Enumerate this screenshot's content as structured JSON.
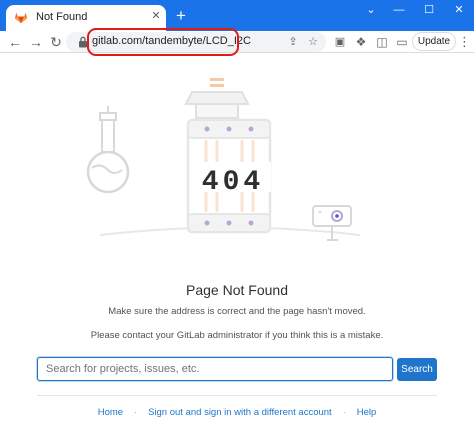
{
  "browser": {
    "tab": {
      "title": "Not Found",
      "favicon": "gitlab-fox-icon",
      "close": "✕"
    },
    "new_tab": "+",
    "window_controls": {
      "minimize": "—",
      "maximize": "☐",
      "close": "✕"
    },
    "nav": {
      "back": "←",
      "forward": "→",
      "reload": "↻"
    },
    "url": "gitlab.com/tandembyte/LCD_I2C",
    "update_label": "Update",
    "menu": "⋮",
    "accent_color": "#1a73e8",
    "highlight_color": "#e01b1b"
  },
  "page": {
    "error_code": "404",
    "title": "Page Not Found",
    "message1": "Make sure the address is correct and the page hasn't moved.",
    "message2": "Please contact your GitLab administrator if you think this is a mistake.",
    "search": {
      "placeholder": "Search for projects, issues, etc.",
      "button": "Search"
    },
    "footer": {
      "home": "Home",
      "sign_out": "Sign out and sign in with a different account",
      "help": "Help",
      "separator": "·"
    },
    "link_color": "#1f75cb"
  }
}
